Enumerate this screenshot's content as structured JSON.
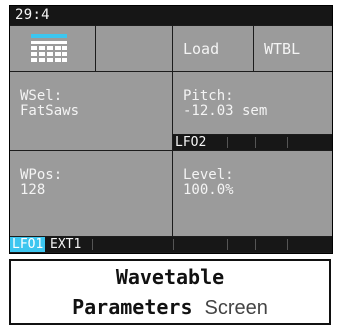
{
  "screen": {
    "title": "29:4",
    "top_row": {
      "icon": "wavetable-grid-icon",
      "load_label": "Load",
      "wtbl_label": "WTBL"
    },
    "params": {
      "wsel_label": "WSel:",
      "wsel_value": "FatSaws",
      "pitch_label": "Pitch:",
      "pitch_value": "-12.03 sem",
      "wpos_label": "WPos:",
      "wpos_value": "128",
      "level_label": "Level:",
      "level_value": "100.0%"
    },
    "mod_tabs_mid": {
      "tab1": "LFO2"
    },
    "mod_tabs_bottom": {
      "tab1": "LFO1",
      "tab2": "EXT1"
    },
    "colors": {
      "accent": "#3cc6f0",
      "cell": "#9b9b9b",
      "background": "#1c1c1c"
    }
  },
  "caption": {
    "line1": "Wavetable",
    "line2_bold": "Parameters",
    "line2_normal": "Screen"
  }
}
